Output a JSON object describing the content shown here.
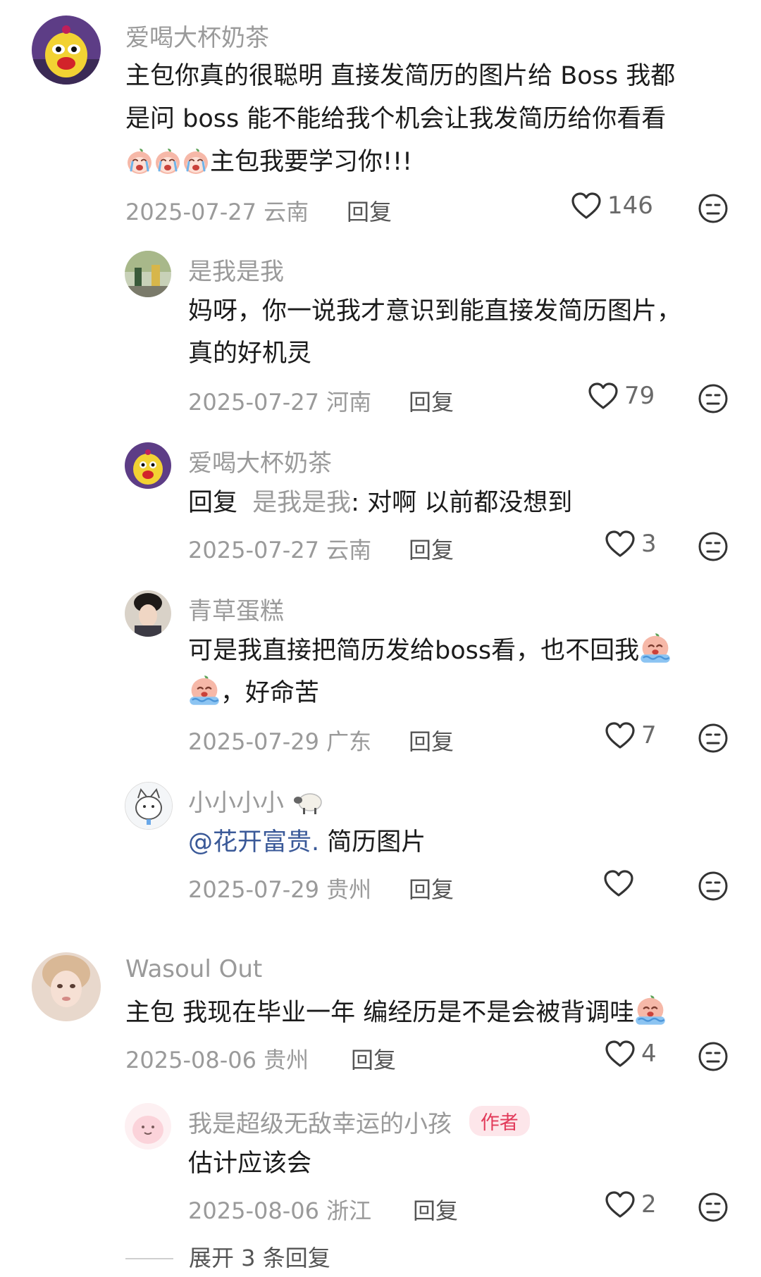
{
  "comments": [
    {
      "username": "爱喝大杯奶茶",
      "text_line1": "主包你真的很聪明 直接发简历的图片给 Boss 我都",
      "text_line2": "是问 boss 能不能给我个机会让我发简历给你看看",
      "text_line3": "主包我要学习你!!!",
      "date_location": "2025-07-27 云南",
      "reply_label": "回复",
      "likes": "146",
      "emoji": [
        "crying-peach-emoji",
        "crying-peach-emoji",
        "crying-peach-emoji"
      ]
    },
    {
      "username": "是我是我",
      "text_line1": "妈呀，你一说我才意识到能直接发简历图片，",
      "text_line2": "真的好机灵",
      "date_location": "2025-07-27 河南",
      "reply_label": "回复",
      "likes": "79"
    },
    {
      "username": "爱喝大杯奶茶",
      "reply_prefix": "回复",
      "reply_to": "是我是我",
      "text": ": 对啊 以前都没想到",
      "date_location": "2025-07-27 云南",
      "reply_label": "回复",
      "likes": "3"
    },
    {
      "username": "青草蛋糕",
      "text_line1": "可是我直接把简历发给boss看，也不回我",
      "text_line2": "，好命苦",
      "date_location": "2025-07-29 广东",
      "reply_label": "回复",
      "likes": "7",
      "emoji": [
        "crying-peach-emoji",
        "crying-peach-emoji"
      ]
    },
    {
      "username": "小小小小",
      "username_emoji": "sheep-emoji",
      "mention": "@花开富贵.",
      "text": " 简历图片",
      "date_location": "2025-07-29 贵州",
      "reply_label": "回复",
      "likes": ""
    },
    {
      "username": "Wasoul Out",
      "text": "主包 我现在毕业一年 编经历是不是会被背调哇",
      "date_location": "2025-08-06 贵州",
      "reply_label": "回复",
      "likes": "4",
      "emoji": [
        "crying-peach-emoji"
      ]
    },
    {
      "username": "我是超级无敌幸运的小孩",
      "author_badge": "作者",
      "text": "估计应该会",
      "date_location": "2025-08-06 浙江",
      "reply_label": "回复",
      "likes": "2"
    }
  ],
  "expand_replies": "展开 3 条回复",
  "colors": {
    "text": "#1b1b1b",
    "meta": "#9a9a9a",
    "mention": "#3a5998",
    "badge_bg": "#fde6ea",
    "badge_text": "#e23a5a"
  }
}
